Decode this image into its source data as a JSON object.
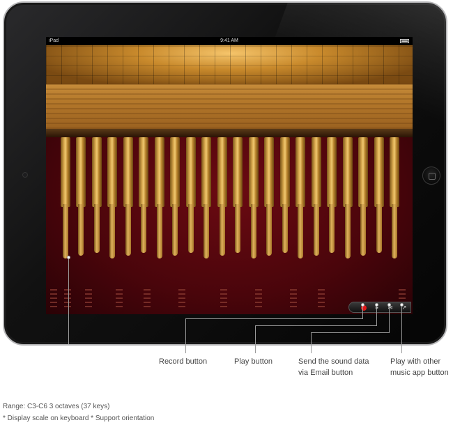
{
  "status_bar": {
    "carrier": "iPad",
    "time": "9:41 AM"
  },
  "toolbar": {
    "record_icon": "record-icon",
    "play_icon": "play-icon",
    "email_icon": "envelope-icon",
    "share_icon": "open-in-app-icon"
  },
  "callouts": {
    "record": "Record button",
    "play": "Play button",
    "email_line1": "Send the sound data",
    "email_line2": "via Email button",
    "other_app_line1": "Play with other",
    "other_app_line2": "music app button"
  },
  "footer": {
    "range": "Range: C3-C6 3 octaves (37 keys)",
    "notes": "* Display scale on keyboard   * Support orientation"
  },
  "colors": {
    "felt": "#4a050b",
    "wood": "#c68c3a",
    "record": "#e01818"
  }
}
